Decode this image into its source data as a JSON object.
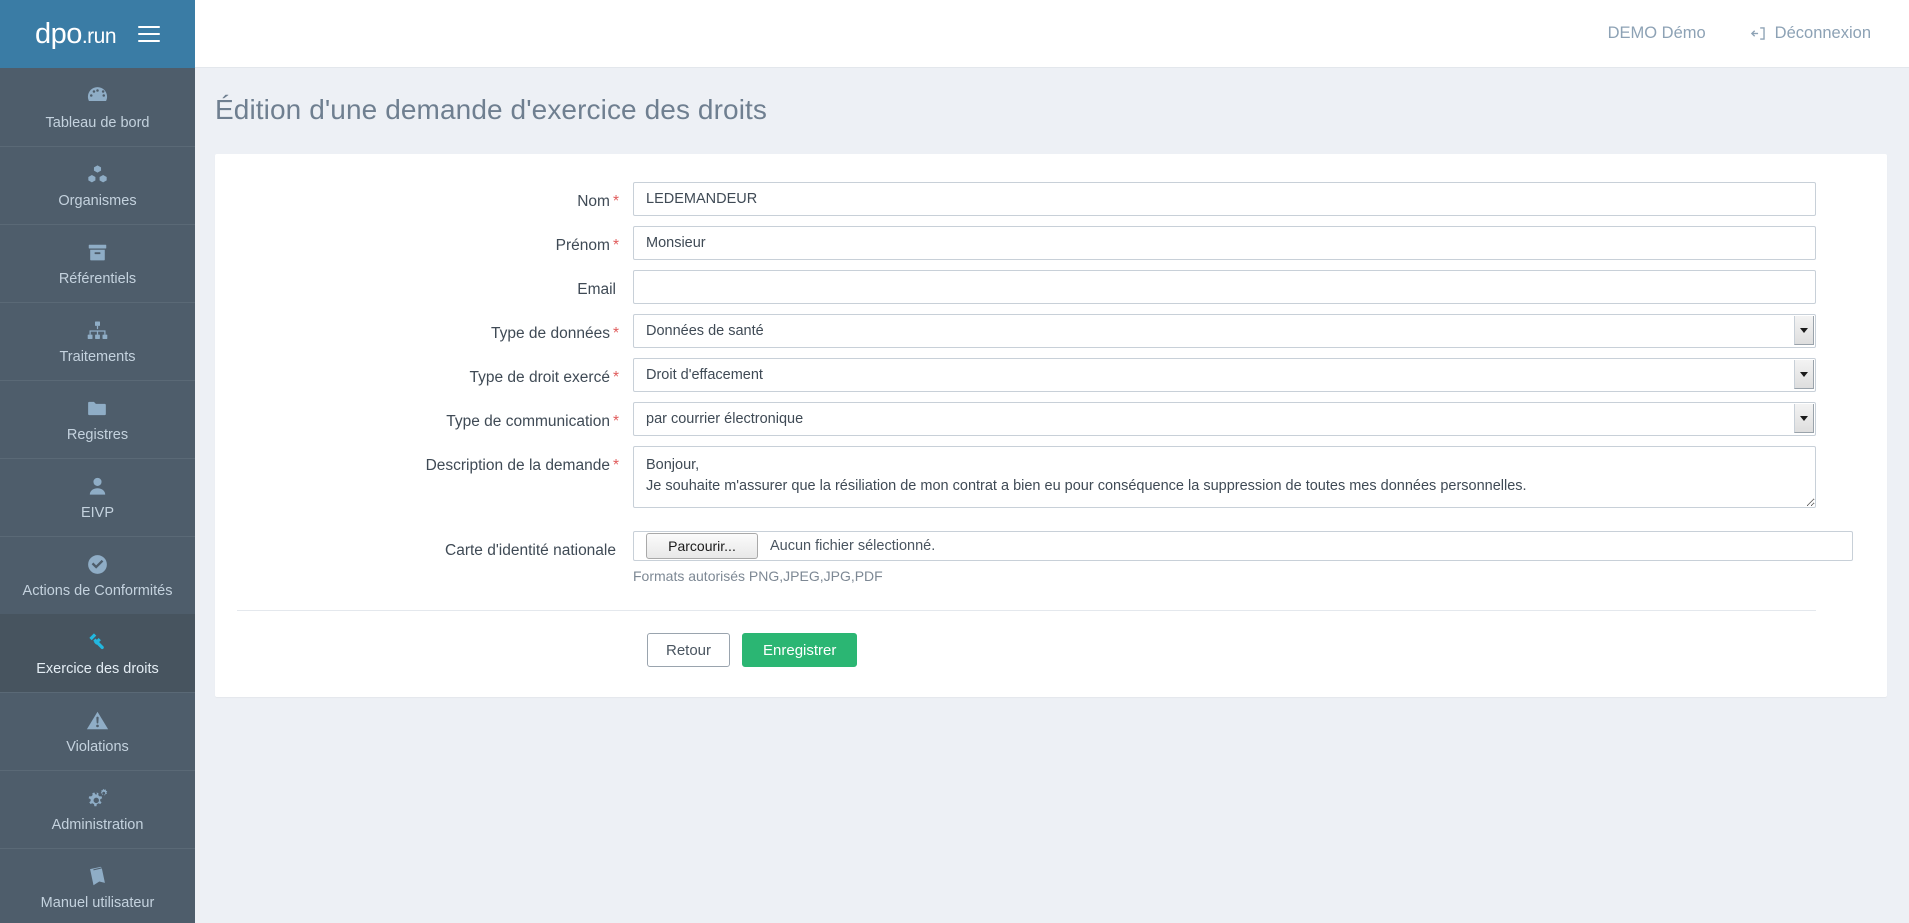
{
  "brand": {
    "logo_main": "dpo",
    "logo_suffix": ".run",
    "menu_icon": "hamburger-icon"
  },
  "header": {
    "user_name": "DEMO Démo",
    "logout_label": "Déconnexion",
    "logout_icon": "sign-out-icon"
  },
  "sidebar": {
    "items": [
      {
        "label": "Tableau de bord",
        "icon": "dashboard-gauge-icon",
        "active": false
      },
      {
        "label": "Organismes",
        "icon": "cubes-icon",
        "active": false
      },
      {
        "label": "Référentiels",
        "icon": "archive-box-icon",
        "active": false
      },
      {
        "label": "Traitements",
        "icon": "sitemap-icon",
        "active": false
      },
      {
        "label": "Registres",
        "icon": "folder-icon",
        "active": false
      },
      {
        "label": "EIVP",
        "icon": "user-icon",
        "active": false
      },
      {
        "label": "Actions de Conformités",
        "icon": "check-circle-icon",
        "active": false
      },
      {
        "label": "Exercice des droits",
        "icon": "gavel-icon",
        "active": true
      },
      {
        "label": "Violations",
        "icon": "warning-triangle-icon",
        "active": false
      },
      {
        "label": "Administration",
        "icon": "gears-icon",
        "active": false
      },
      {
        "label": "Manuel utilisateur",
        "icon": "book-icon",
        "active": false
      }
    ]
  },
  "page": {
    "title": "Édition d'une demande d'exercice des droits"
  },
  "form": {
    "fields": {
      "nom": {
        "label": "Nom",
        "required_marker": "*",
        "value": "LEDEMANDEUR",
        "placeholder": ""
      },
      "prenom": {
        "label": "Prénom",
        "required_marker": "*",
        "value": "Monsieur",
        "placeholder": ""
      },
      "email": {
        "label": "Email",
        "required_marker": "",
        "value": "",
        "placeholder": ""
      },
      "type_donnees": {
        "label": "Type de données",
        "required_marker": "*",
        "value": "Données de santé"
      },
      "type_droit": {
        "label": "Type de droit exercé",
        "required_marker": "*",
        "value": "Droit d'effacement"
      },
      "type_communication": {
        "label": "Type de communication",
        "required_marker": "*",
        "value": "par courrier électronique"
      },
      "description": {
        "label": "Description de la demande",
        "required_marker": "*",
        "value": "Bonjour,\nJe souhaite m'assurer que la résiliation de mon contrat a bien eu pour conséquence la suppression de toutes mes données personnelles."
      },
      "carte_identite": {
        "label": "Carte d'identité nationale",
        "required_marker": "",
        "browse_label": "Parcourir...",
        "status_text": "Aucun fichier sélectionné.",
        "help_text": "Formats autorisés PNG,JPEG,JPG,PDF"
      }
    },
    "actions": {
      "back_label": "Retour",
      "save_label": "Enregistrer"
    }
  },
  "colors": {
    "brand_blue": "#3a7ca5",
    "sidebar_bg": "#4e5d6b",
    "sidebar_active_bg": "#47545f",
    "sidebar_active_icon": "#22b8e0",
    "body_bg": "#edf0f5",
    "required_red": "#e05c5c",
    "success_green": "#2bb673"
  }
}
